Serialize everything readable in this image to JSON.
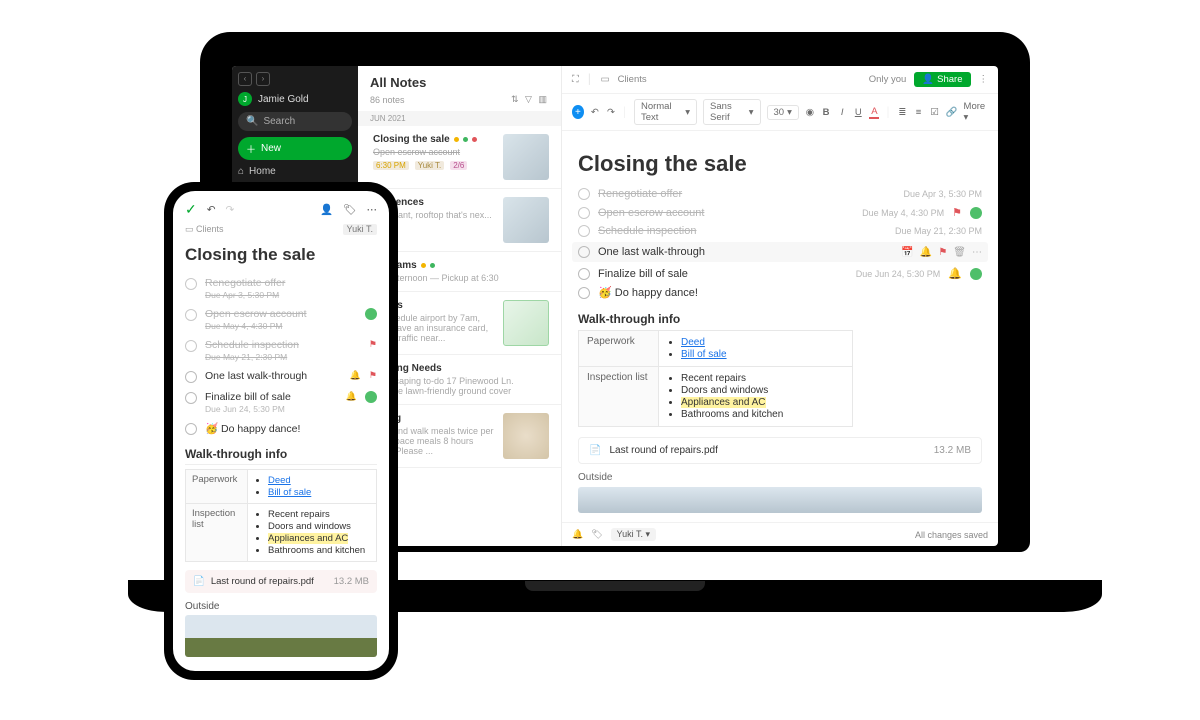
{
  "sidebar": {
    "user": "Jamie Gold",
    "avatarInitial": "J",
    "search": "Search",
    "newLabel": "New",
    "home": "Home"
  },
  "noteList": {
    "title": "All Notes",
    "count": "86 notes",
    "dateHeader": "JUN 2021",
    "notes": [
      {
        "title": "Closing the sale",
        "snippet": "Open escrow account",
        "meta1": "6:30 PM",
        "tag": "Yuki T.",
        "badge": "2/6"
      },
      {
        "title": "References",
        "snippet": "restaurant, rooftop that's nex..."
      },
      {
        "title": "Programs",
        "snippet": "pool afternoon — Pickup at 6:30"
      },
      {
        "title": "Details",
        "snippet": "Reschedule airport by 7am, Must have an insurance card, check traffic near..."
      },
      {
        "title": "Scaping Needs",
        "snippet": "Landscaping to-do 17 Pinewood Ln. Replace lawn-friendly ground cover"
      },
      {
        "title": "Sitting",
        "snippet": "Feed and walk meals twice per day. Space meals 8 hours apart. Please ..."
      }
    ]
  },
  "editor": {
    "crumb": "Clients",
    "visibility": "Only you",
    "share": "Share",
    "toolbar": {
      "style": "Normal Text",
      "font": "Sans Serif",
      "size": "30",
      "more": "More"
    },
    "title": "Closing the sale",
    "tasks": [
      {
        "text": "Renegotiate offer",
        "due": "Due Apr 3, 5:30 PM",
        "done": true
      },
      {
        "text": "Open escrow account",
        "due": "Due May 4, 4:30 PM",
        "done": true,
        "flag": true,
        "avatar": true
      },
      {
        "text": "Schedule inspection",
        "due": "Due May 21, 2:30 PM",
        "done": true
      },
      {
        "text": "One last walk-through",
        "due": "",
        "done": false,
        "focus": true
      },
      {
        "text": "Finalize bill of sale",
        "due": "Due Jun 24, 5:30 PM",
        "done": false,
        "bell": true,
        "avatar": true
      },
      {
        "text": "🥳 Do happy dance!",
        "due": "",
        "done": false
      }
    ],
    "sectionHead": "Walk-through info",
    "paperworkLabel": "Paperwork",
    "inspectionLabel": "Inspection list",
    "paperwork": [
      "Deed",
      "Bill of sale"
    ],
    "inspection": [
      "Recent repairs",
      "Doors and windows",
      "Appliances and AC",
      "Bathrooms and kitchen"
    ],
    "attachment": {
      "name": "Last round of repairs.pdf",
      "size": "13.2 MB"
    },
    "outside": "Outside",
    "assignee": "Yuki T.",
    "status": "All changes saved"
  },
  "phone": {
    "crumb": "Clients",
    "chip": "Yuki T.",
    "title": "Closing the sale",
    "tasks": [
      {
        "text": "Renegotiate offer",
        "sub": "Due Apr 3, 5:30 PM",
        "done": true
      },
      {
        "text": "Open escrow account",
        "sub": "Due May 4, 4:30 PM",
        "done": true,
        "avatar": true
      },
      {
        "text": "Schedule inspection",
        "sub": "Due May 21, 2:30 PM",
        "done": true,
        "flag": true
      },
      {
        "text": "One last walk-through",
        "done": false,
        "bell": true,
        "flag": true
      },
      {
        "text": "Finalize bill of sale",
        "sub": "Due Jun 24, 5:30 PM",
        "done": false,
        "bell": true,
        "avatar": true
      },
      {
        "text": "🥳 Do happy dance!",
        "done": false
      }
    ],
    "sectionHead": "Walk-through info",
    "paperworkLabel": "Paperwork",
    "inspectionLabel": "Inspection list",
    "paperwork": [
      "Deed",
      "Bill of sale"
    ],
    "inspection": [
      "Recent repairs",
      "Doors and windows",
      "Appliances and AC",
      "Bathrooms and kitchen"
    ],
    "attachment": {
      "name": "Last round of repairs.pdf",
      "size": "13.2 MB"
    },
    "outside": "Outside"
  }
}
